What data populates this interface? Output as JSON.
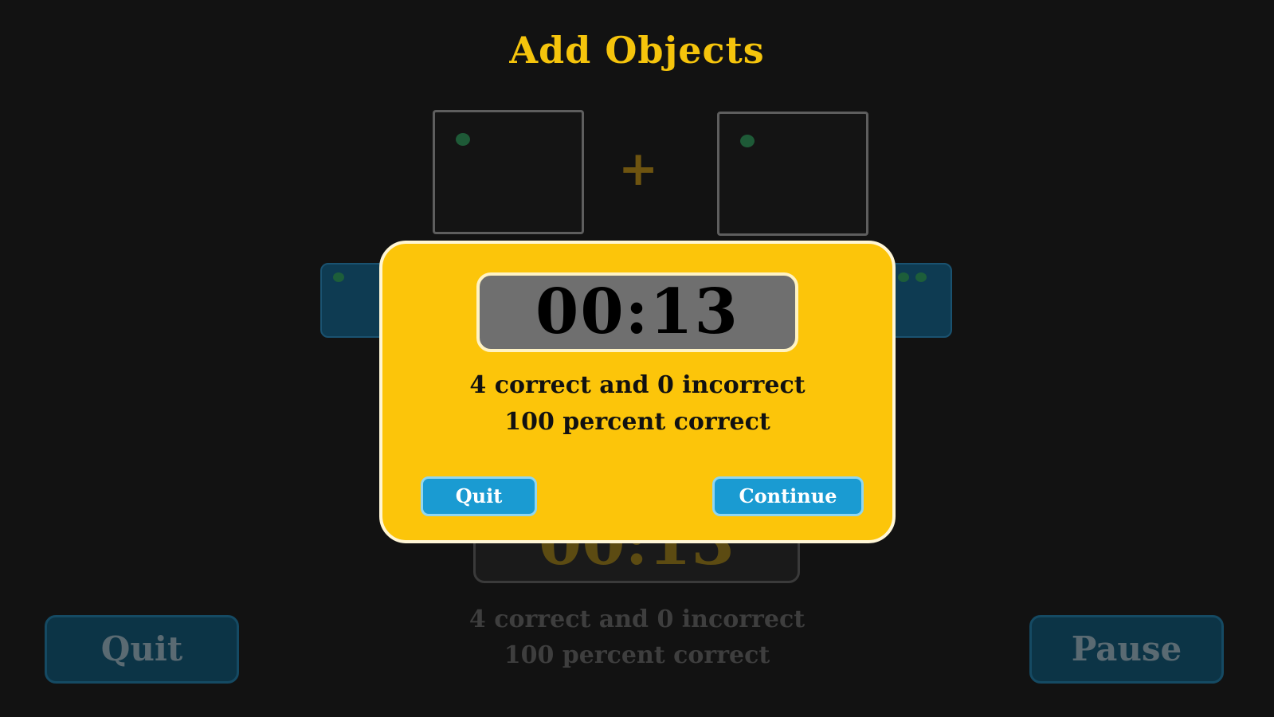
{
  "game": {
    "title": "Add Objects",
    "operator": "+",
    "timer": "00:13",
    "stats_line1": "4 correct and 0 incorrect",
    "stats_line2": "100 percent correct",
    "quit_label": "Quit",
    "pause_label": "Pause"
  },
  "modal": {
    "timer": "00:13",
    "stats_line1": "4 correct and 0 incorrect",
    "stats_line2": "100 percent correct",
    "quit_label": "Quit",
    "continue_label": "Continue"
  },
  "colors": {
    "background": "#121212",
    "title": "#f5c40c",
    "modal": "#fcc50a",
    "button": "#1a9bd2"
  }
}
